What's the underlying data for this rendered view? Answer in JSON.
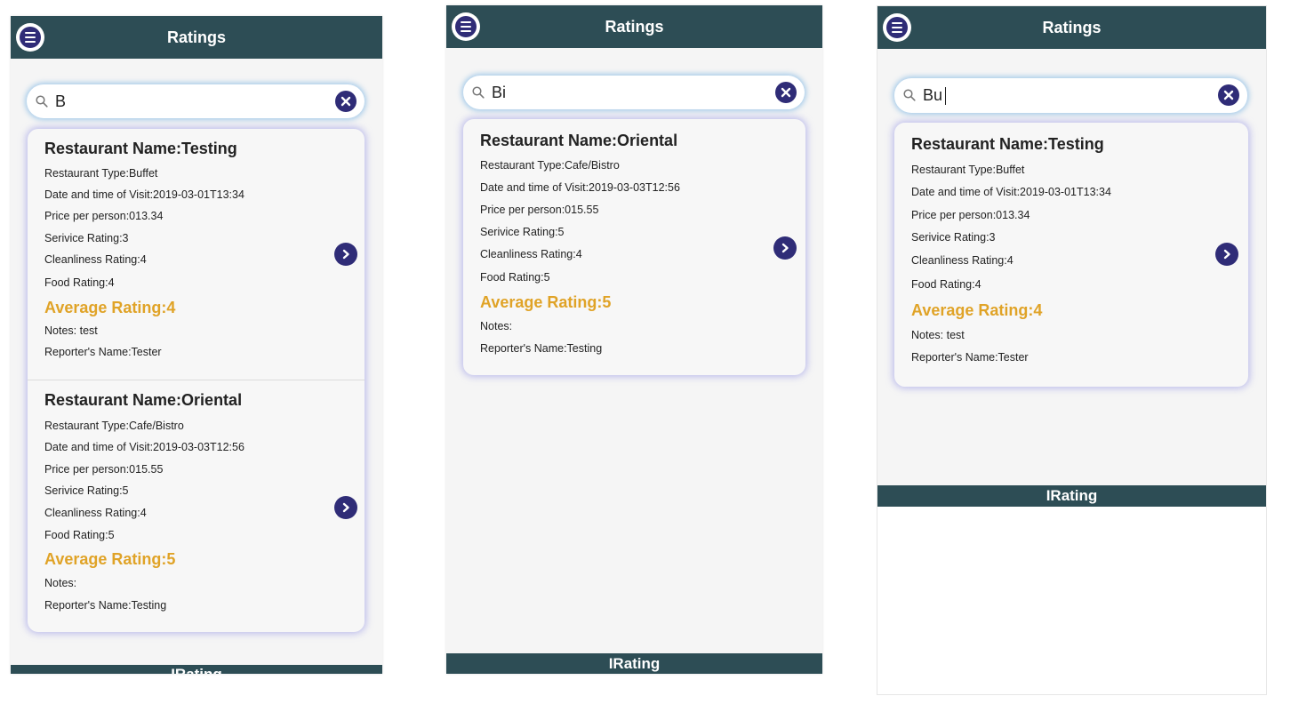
{
  "colors": {
    "header": "#2d4d55",
    "icon_bg": "#2f2c77",
    "average": "#e0a327"
  },
  "icons": {
    "menu": "menu-icon",
    "search": "search-icon",
    "clear": "clear-icon",
    "chevron": "chevron-right-icon"
  },
  "screens": [
    {
      "title": "Ratings",
      "search_value": "B",
      "footer": "IRating",
      "results": [
        {
          "name": "Restaurant Name:Testing",
          "type": "Restaurant Type:Buffet",
          "visit": "Date and time of Visit:2019-03-01T13:34",
          "price": "Price per person:013.34",
          "service": "Serivice Rating:3",
          "clean": "Cleanliness Rating:4",
          "food": "Food Rating:4",
          "average": "Average Rating:4",
          "notes": "Notes: test",
          "reporter": "Reporter's Name:Tester"
        },
        {
          "name": "Restaurant Name:Oriental",
          "type": "Restaurant Type:Cafe/Bistro",
          "visit": "Date and time of Visit:2019-03-03T12:56",
          "price": "Price per person:015.55",
          "service": "Serivice Rating:5",
          "clean": "Cleanliness Rating:4",
          "food": "Food Rating:5",
          "average": "Average Rating:5",
          "notes": "Notes:",
          "reporter": "Reporter's Name:Testing"
        }
      ]
    },
    {
      "title": "Ratings",
      "search_value": "Bi",
      "footer": "IRating",
      "results": [
        {
          "name": "Restaurant Name:Oriental",
          "type": "Restaurant Type:Cafe/Bistro",
          "visit": "Date and time of Visit:2019-03-03T12:56",
          "price": "Price per person:015.55",
          "service": "Serivice Rating:5",
          "clean": "Cleanliness Rating:4",
          "food": "Food Rating:5",
          "average": "Average Rating:5",
          "notes": "Notes:",
          "reporter": "Reporter's Name:Testing"
        }
      ]
    },
    {
      "title": "Ratings",
      "search_value": "Bu",
      "footer": "IRating",
      "results": [
        {
          "name": "Restaurant Name:Testing",
          "type": "Restaurant Type:Buffet",
          "visit": "Date and time of Visit:2019-03-01T13:34",
          "price": "Price per person:013.34",
          "service": "Serivice Rating:3",
          "clean": "Cleanliness Rating:4",
          "food": "Food Rating:4",
          "average": "Average Rating:4",
          "notes": "Notes: test",
          "reporter": "Reporter's Name:Tester"
        }
      ]
    }
  ]
}
